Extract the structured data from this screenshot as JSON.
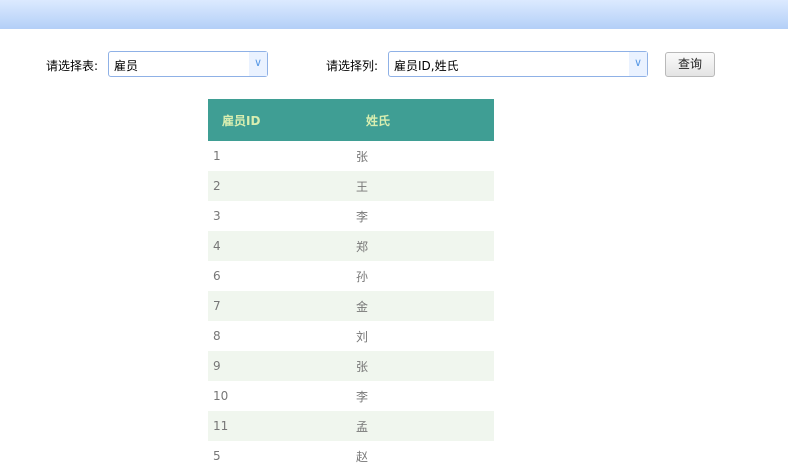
{
  "filters": {
    "table_label": "请选择表:",
    "table_value": "雇员",
    "column_label": "请选择列:",
    "column_value": "雇员ID,姓氏",
    "query_button": "查询"
  },
  "table": {
    "headers": [
      "雇员ID",
      "姓氏"
    ],
    "rows": [
      [
        "1",
        "张"
      ],
      [
        "2",
        "王"
      ],
      [
        "3",
        "李"
      ],
      [
        "4",
        "郑"
      ],
      [
        "6",
        "孙"
      ],
      [
        "7",
        "金"
      ],
      [
        "8",
        "刘"
      ],
      [
        "9",
        "张"
      ],
      [
        "10",
        "李"
      ],
      [
        "11",
        "孟"
      ],
      [
        "5",
        "赵"
      ]
    ]
  }
}
